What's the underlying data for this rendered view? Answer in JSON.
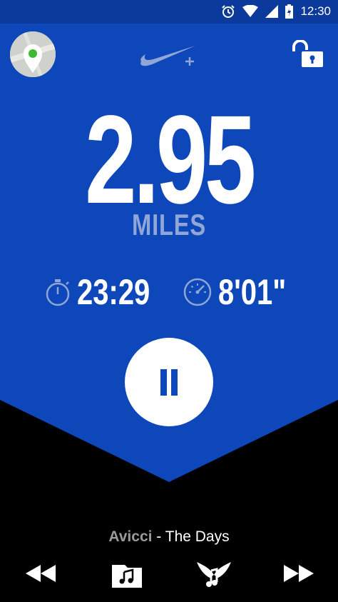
{
  "status": {
    "time": "12:30"
  },
  "run": {
    "distance": "2.95",
    "unit": "MILES",
    "duration": "23:29",
    "pace": "8'01\""
  },
  "player": {
    "artist": "Avicci",
    "title": "- The Days"
  },
  "colors": {
    "panel_blue": "#0d47b9",
    "status_blue": "#0b3a9c",
    "muted_text": "#8fa6d6",
    "map_pin": "#3cba32"
  }
}
